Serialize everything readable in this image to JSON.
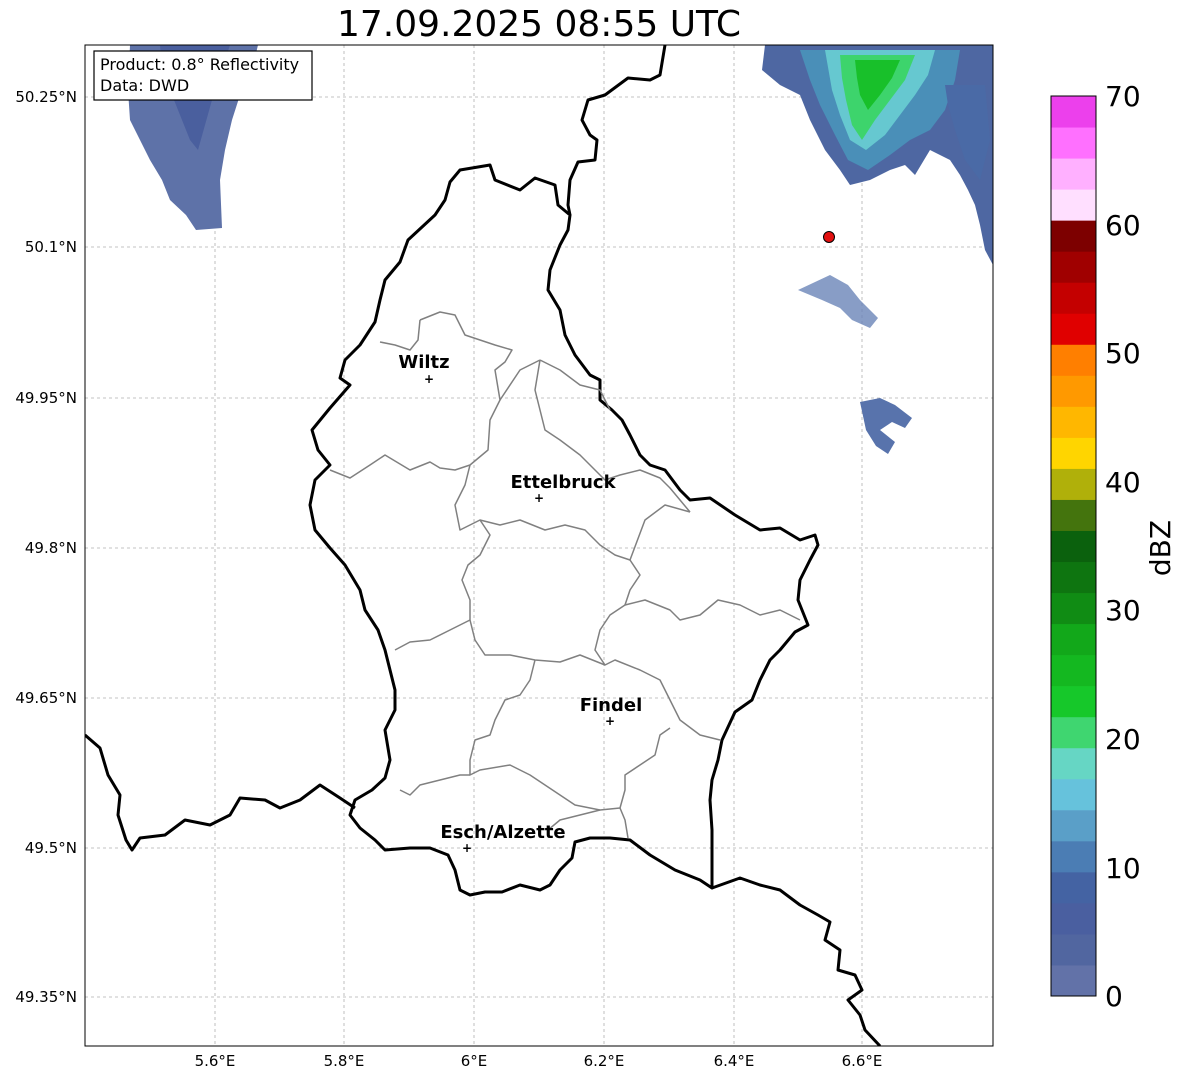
{
  "title": "17.09.2025 08:55 UTC",
  "info_box": {
    "line1": "Product: 0.8° Reflectivity",
    "line2": "Data: DWD"
  },
  "lat_ticks": [
    "50.25°N",
    "50.1°N",
    "49.95°N",
    "49.8°N",
    "49.65°N",
    "49.5°N",
    "49.35°N"
  ],
  "lon_ticks": [
    "5.6°E",
    "5.8°E",
    "6°E",
    "6.2°E",
    "6.4°E",
    "6.6°E"
  ],
  "cities": [
    {
      "name": "Wiltz"
    },
    {
      "name": "Ettelbruck"
    },
    {
      "name": "Findel"
    },
    {
      "name": "Esch/Alzette"
    }
  ],
  "colorbar": {
    "label": "dBZ",
    "tick_labels": [
      "0",
      "10",
      "20",
      "30",
      "40",
      "50",
      "60",
      "70"
    ],
    "colors": [
      "#6272a8",
      "#5166a0",
      "#4a5fa0",
      "#4463a3",
      "#4b7db4",
      "#5a9fc8",
      "#66c2dc",
      "#66d6c4",
      "#3fd670",
      "#16c82a",
      "#14b820",
      "#12a81a",
      "#108c14",
      "#0e7510",
      "#0b610d",
      "#44740d",
      "#b0b00a",
      "#ffd500",
      "#ffb700",
      "#ff9900",
      "#ff7f00",
      "#e00000",
      "#c40000",
      "#a00000",
      "#7d0000",
      "#ffdfff",
      "#ffb0ff",
      "#ff70ff",
      "#ec40ec"
    ]
  },
  "colors": {
    "marker": "#e21010",
    "border": "#000000",
    "canton": "#808080",
    "grid": "#b0b0b0"
  }
}
